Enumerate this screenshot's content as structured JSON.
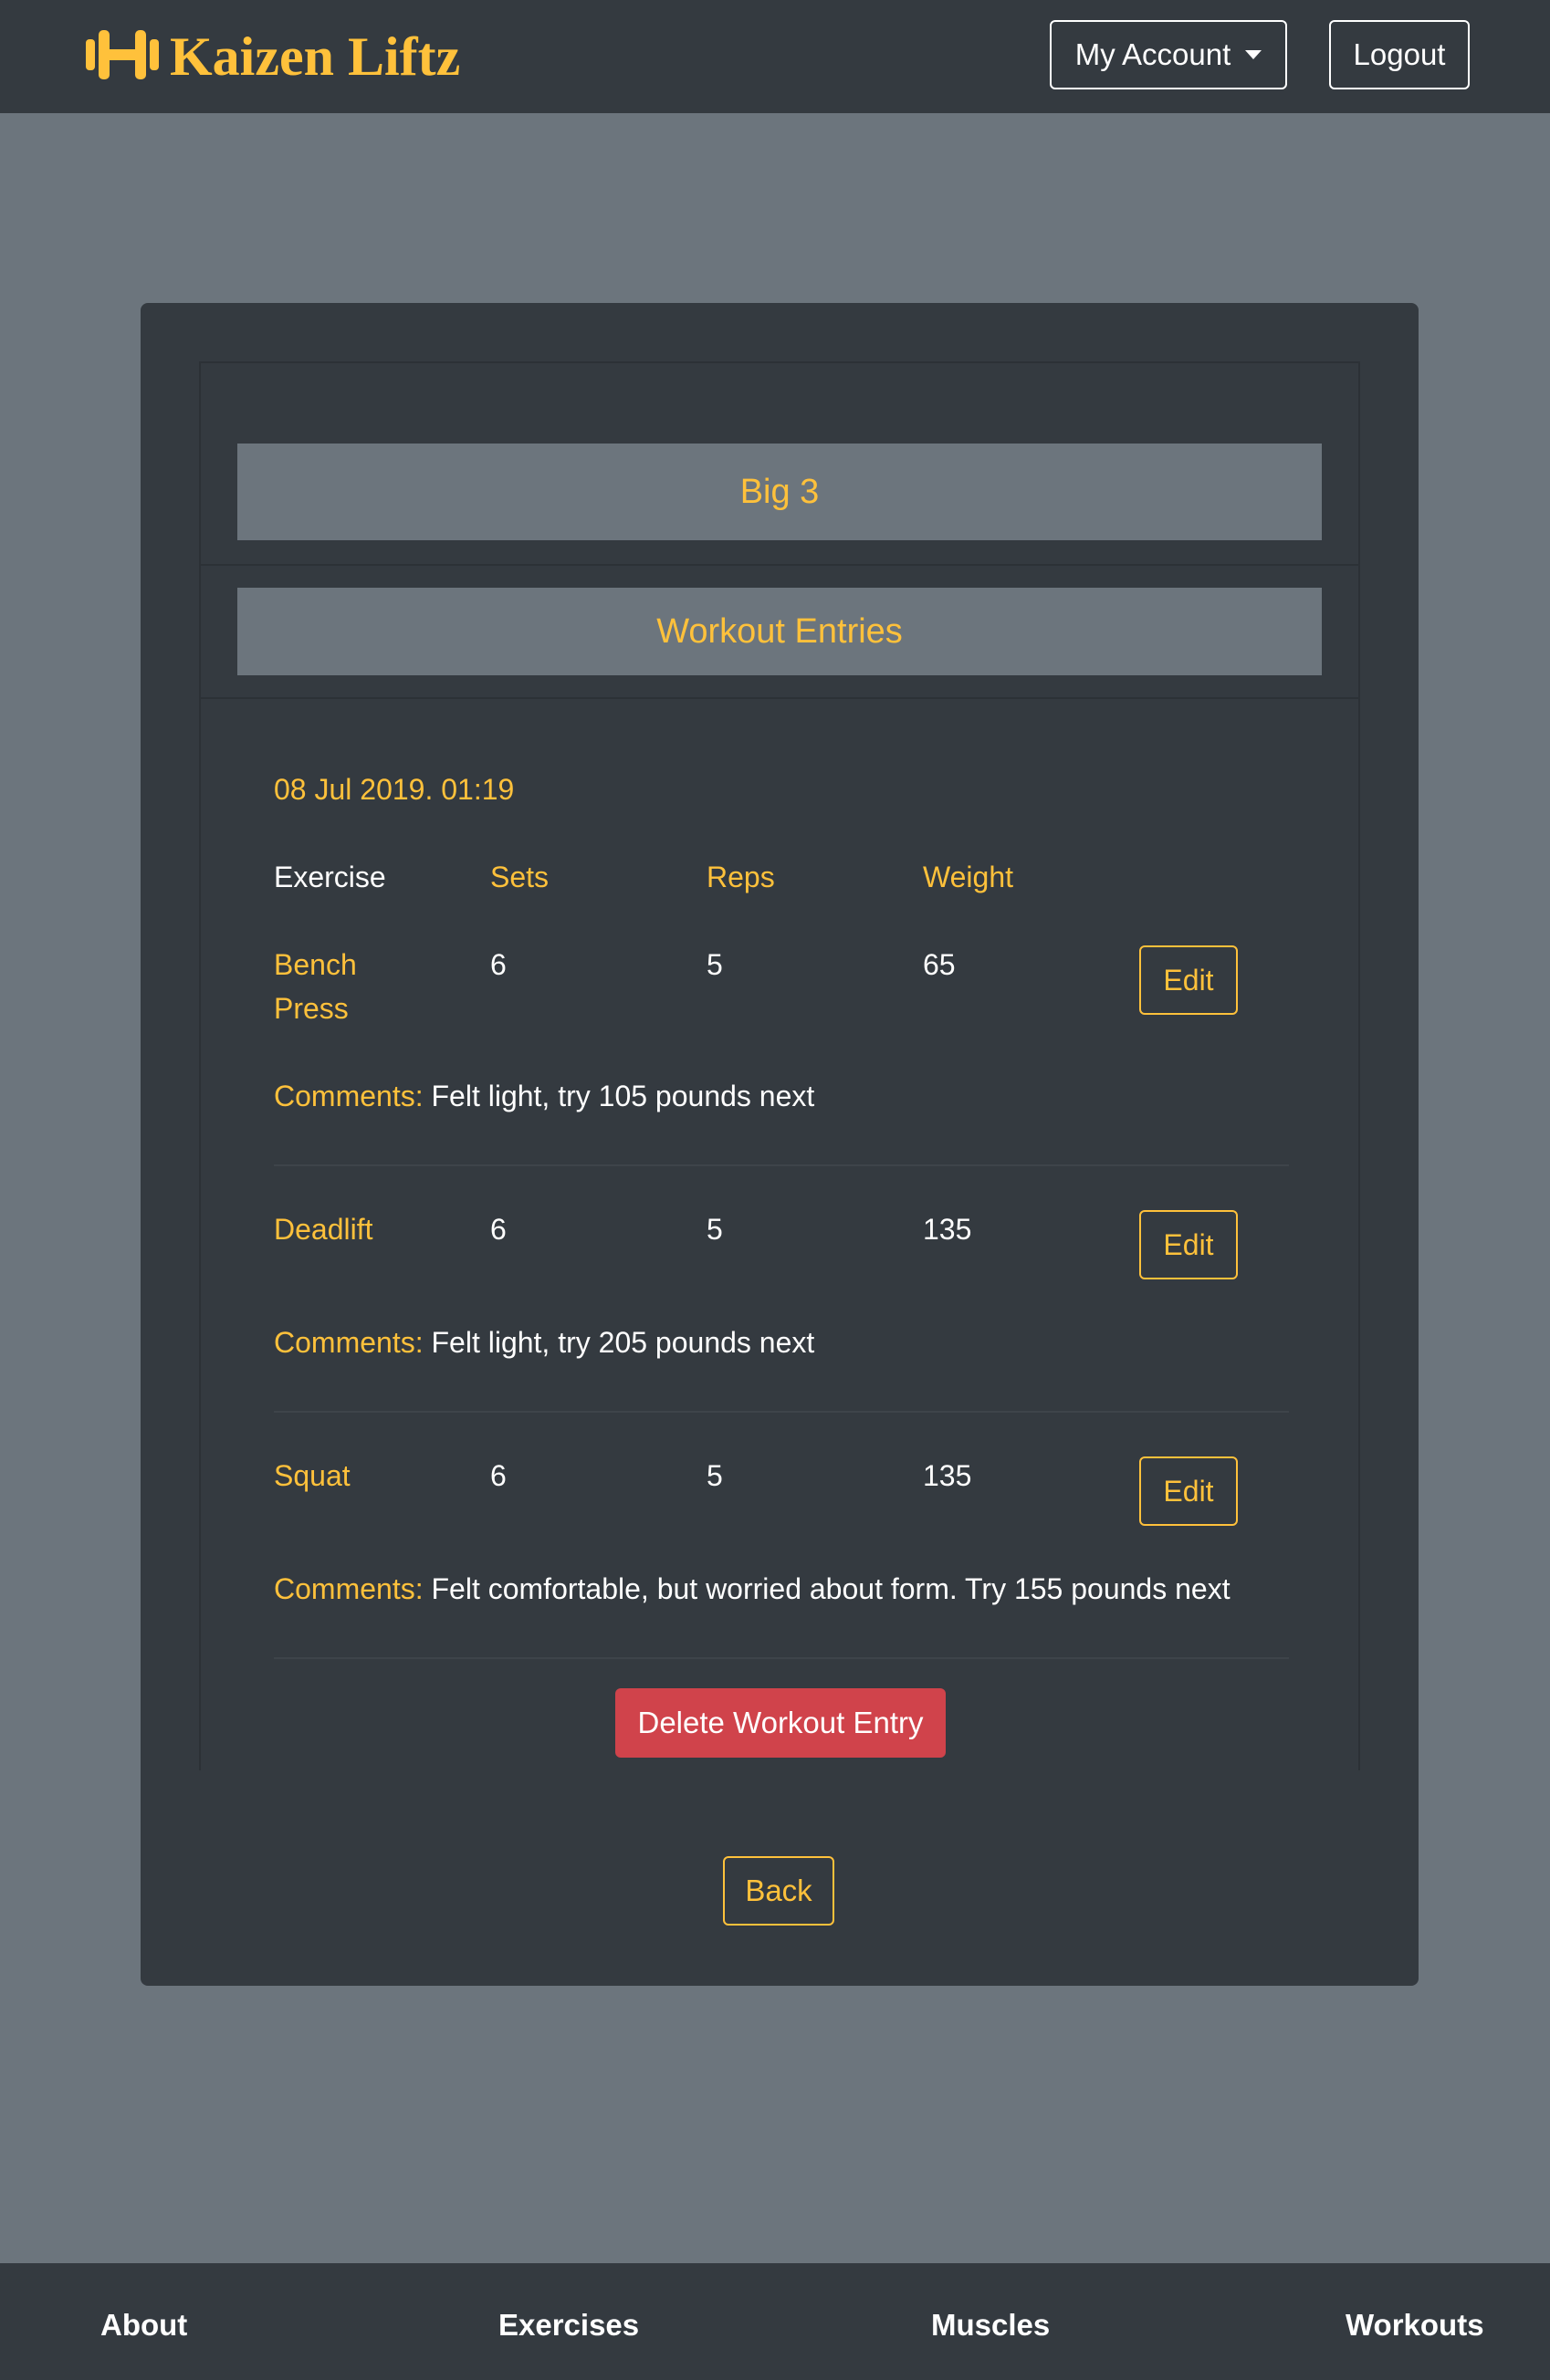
{
  "navbar": {
    "brand_name": "Kaizen Liftz",
    "brand_icon": "dumbbell-icon",
    "account_label": "My Account",
    "logout_label": "Logout"
  },
  "workout": {
    "title": "Big 3",
    "entries_heading": "Workout Entries",
    "entry_date": "08 Jul 2019. 01:19",
    "columns": {
      "exercise": "Exercise",
      "sets": "Sets",
      "reps": "Reps",
      "weight": "Weight"
    },
    "rows": [
      {
        "exercise_line1": "Bench",
        "exercise_line2": "Press",
        "sets": "6",
        "reps": "5",
        "weight": "65",
        "edit_label": "Edit",
        "comments_label": "Comments:",
        "comments": "Felt light, try 105 pounds next"
      },
      {
        "exercise": "Deadlift",
        "sets": "6",
        "reps": "5",
        "weight": "135",
        "edit_label": "Edit",
        "comments_label": "Comments:",
        "comments": "Felt light, try 205 pounds next"
      },
      {
        "exercise": "Squat",
        "sets": "6",
        "reps": "5",
        "weight": "135",
        "edit_label": "Edit",
        "comments_label": "Comments:",
        "comments": "Felt comfortable, but worried about form. Try 155 pounds next"
      }
    ],
    "delete_label": "Delete Workout Entry",
    "back_label": "Back"
  },
  "footer": {
    "links": [
      "About",
      "Exercises",
      "Muscles",
      "Workouts"
    ]
  },
  "colors": {
    "accent": "#ffc13b",
    "dark": "#343a40",
    "muted": "#6c757d",
    "danger": "#d0434b"
  }
}
